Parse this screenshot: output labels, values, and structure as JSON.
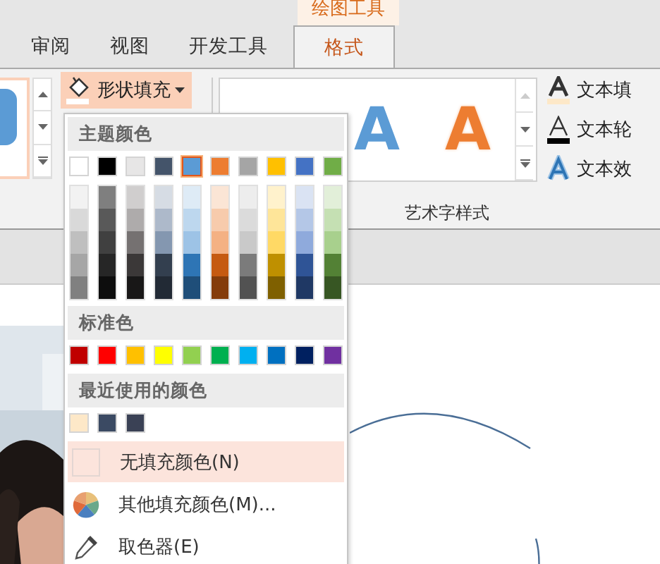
{
  "context_tab": {
    "label": "绘图工具"
  },
  "tabs": [
    {
      "label": "审阅",
      "selected": false
    },
    {
      "label": "视图",
      "selected": false
    },
    {
      "label": "开发工具",
      "selected": false
    },
    {
      "label": "格式",
      "selected": true
    }
  ],
  "ribbon": {
    "fill_button": {
      "label": "形状填充",
      "expanded": true
    },
    "wordart_gallery": [
      {
        "text": "A",
        "kind": "blue-outline"
      },
      {
        "text": "A",
        "kind": "orange-outline"
      }
    ],
    "text_commands": [
      {
        "label": "文本填",
        "kind": "fill"
      },
      {
        "label": "文本轮",
        "kind": "outline"
      },
      {
        "label": "文本效",
        "kind": "effects"
      }
    ],
    "group_label": "艺术字样式"
  },
  "color_menu": {
    "theme_header": "主题颜色",
    "theme_colors": [
      {
        "color": "#ffffff",
        "selected": false
      },
      {
        "color": "#000000",
        "selected": false
      },
      {
        "color": "#e7e6e6",
        "selected": false
      },
      {
        "color": "#44546a",
        "selected": false
      },
      {
        "color": "#5b9bd5",
        "selected": true
      },
      {
        "color": "#ed7d31",
        "selected": false
      },
      {
        "color": "#a5a5a5",
        "selected": false
      },
      {
        "color": "#ffc000",
        "selected": false
      },
      {
        "color": "#4472c4",
        "selected": false
      },
      {
        "color": "#70ad47",
        "selected": false
      }
    ],
    "shades": [
      [
        {
          "color": "#f2f2f2"
        },
        {
          "color": "#d9d9d9"
        },
        {
          "color": "#bfbfbf"
        },
        {
          "color": "#a6a6a6"
        },
        {
          "color": "#808080"
        }
      ],
      [
        {
          "color": "#7f7f7f"
        },
        {
          "color": "#595959"
        },
        {
          "color": "#404040"
        },
        {
          "color": "#262626"
        },
        {
          "color": "#0d0d0d"
        }
      ],
      [
        {
          "color": "#d0cece"
        },
        {
          "color": "#aeabab"
        },
        {
          "color": "#757171"
        },
        {
          "color": "#3b3838"
        },
        {
          "color": "#181717"
        }
      ],
      [
        {
          "color": "#d6dce4"
        },
        {
          "color": "#adb9ca"
        },
        {
          "color": "#8497b0"
        },
        {
          "color": "#333f4f"
        },
        {
          "color": "#222a35"
        }
      ],
      [
        {
          "color": "#deebf6"
        },
        {
          "color": "#bdd7ee"
        },
        {
          "color": "#9dc3e6"
        },
        {
          "color": "#2e75b5"
        },
        {
          "color": "#1f4e79"
        }
      ],
      [
        {
          "color": "#fbe5d5"
        },
        {
          "color": "#f7cbac"
        },
        {
          "color": "#f4b183"
        },
        {
          "color": "#c55a11"
        },
        {
          "color": "#843c0b"
        }
      ],
      [
        {
          "color": "#ededed"
        },
        {
          "color": "#dbdbdb"
        },
        {
          "color": "#c9c9c9"
        },
        {
          "color": "#7b7b7b"
        },
        {
          "color": "#525252"
        }
      ],
      [
        {
          "color": "#fff2cc"
        },
        {
          "color": "#fee599"
        },
        {
          "color": "#ffd965"
        },
        {
          "color": "#bf9000"
        },
        {
          "color": "#7f6000"
        }
      ],
      [
        {
          "color": "#dae3f3"
        },
        {
          "color": "#b4c7e7"
        },
        {
          "color": "#8faadc"
        },
        {
          "color": "#2f5496"
        },
        {
          "color": "#1f3864"
        }
      ],
      [
        {
          "color": "#e2efd9"
        },
        {
          "color": "#c5e0b3"
        },
        {
          "color": "#a8d08d"
        },
        {
          "color": "#538135"
        },
        {
          "color": "#375623"
        }
      ]
    ],
    "standard_header": "标准色",
    "standard_colors": [
      {
        "color": "#c00000"
      },
      {
        "color": "#ff0000"
      },
      {
        "color": "#ffc000"
      },
      {
        "color": "#ffff00"
      },
      {
        "color": "#92d050"
      },
      {
        "color": "#00b050"
      },
      {
        "color": "#00b0f0"
      },
      {
        "color": "#0070c0"
      },
      {
        "color": "#002060"
      },
      {
        "color": "#7030a0"
      }
    ],
    "recent_header": "最近使用的颜色",
    "recent_colors": [
      {
        "color": "#fde8c8"
      },
      {
        "color": "#3b4a63"
      },
      {
        "color": "#3a4155"
      }
    ],
    "items": [
      {
        "label": "无填充颜色(N)",
        "kind": "no-fill",
        "selected": true
      },
      {
        "label": "其他填充颜色(M)...",
        "kind": "more",
        "selected": false
      },
      {
        "label": "取色器(E)",
        "kind": "picker",
        "selected": false
      }
    ]
  }
}
